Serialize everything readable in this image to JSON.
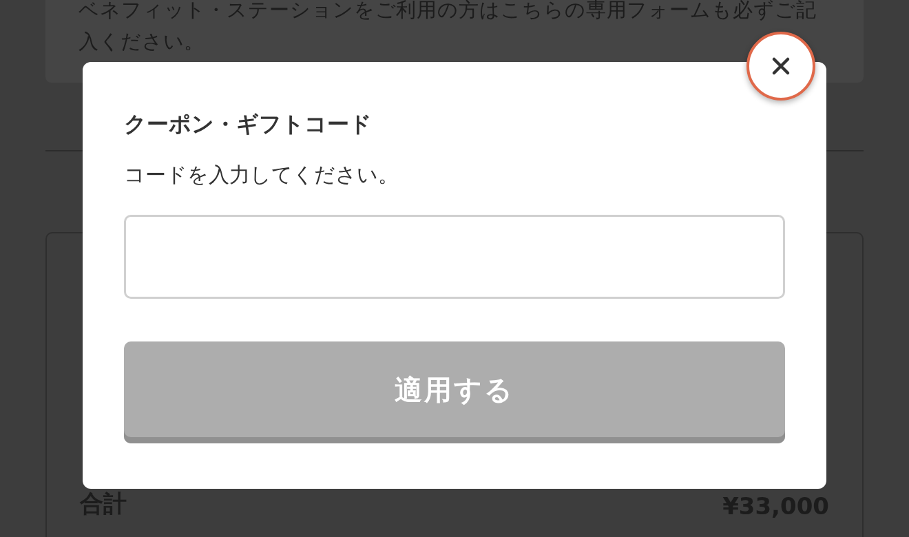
{
  "page": {
    "notice": "ベネフィット・ステーションをご利用の方はこちらの専用フォームも必ずご記入ください。",
    "total": {
      "label": "合計",
      "value": "¥33,000"
    }
  },
  "dialog": {
    "title": "クーポン・ギフトコード",
    "instruction": "コードを入力してください。",
    "apply_button": {
      "label": "適用する",
      "disabled": true
    }
  }
}
